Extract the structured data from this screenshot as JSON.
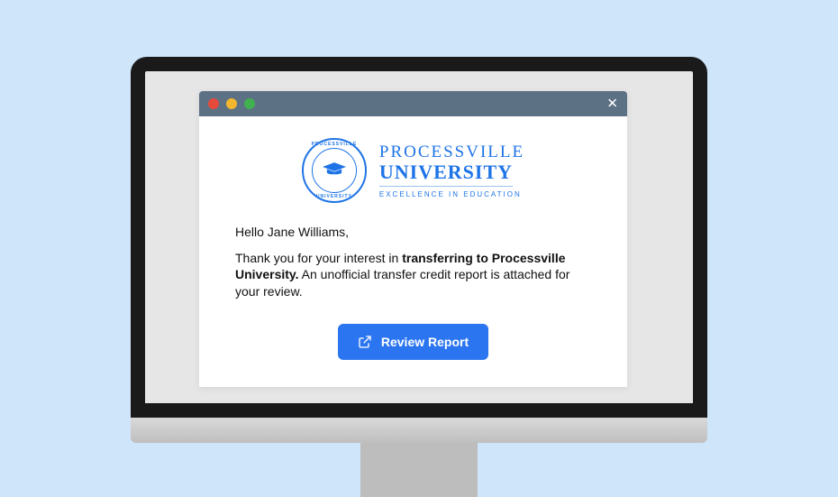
{
  "brand": {
    "seal_top": "PROCESSVILLE",
    "seal_bottom": "UNIVERSITY",
    "line1": "PROCESSVILLE",
    "line2": "UNIVERSITY",
    "tagline": "EXCELLENCE IN EDUCATION"
  },
  "email": {
    "greeting": "Hello Jane Williams,",
    "body_pre": "Thank you for your interest in ",
    "body_bold": "transferring to Processville University.",
    "body_post": " An unofficial transfer credit report is attached for your review."
  },
  "cta": {
    "label": "Review Report"
  },
  "colors": {
    "page_bg": "#cfe5f9",
    "titlebar": "#5d7185",
    "brand": "#1e74e6",
    "button": "#2b76f0"
  }
}
